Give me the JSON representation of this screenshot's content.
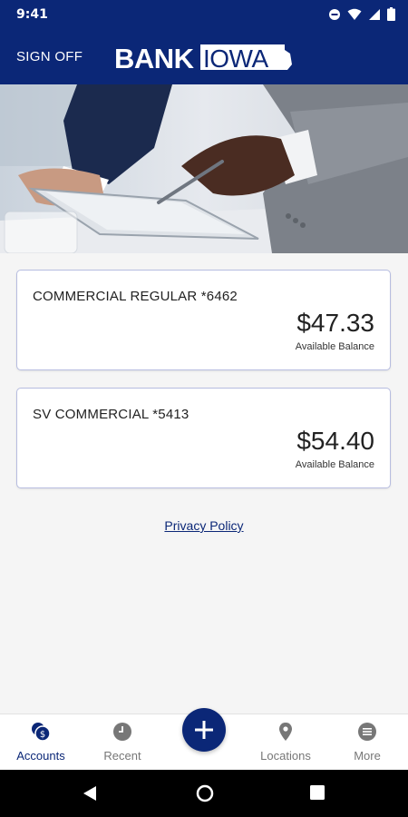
{
  "status_bar": {
    "time": "9:41"
  },
  "header": {
    "sign_off_label": "SIGN OFF",
    "logo_left": "BANK",
    "logo_right": "IOWA"
  },
  "accounts": [
    {
      "name": "COMMERCIAL REGULAR *6462",
      "balance": "$47.33",
      "balance_label": "Available Balance"
    },
    {
      "name": "SV COMMERCIAL *5413",
      "balance": "$54.40",
      "balance_label": "Available Balance"
    }
  ],
  "footer": {
    "privacy_label": "Privacy Policy"
  },
  "bottom_nav": {
    "items": [
      {
        "label": "Accounts",
        "icon": "accounts-icon",
        "active": true
      },
      {
        "label": "Recent",
        "icon": "clock-icon"
      },
      {
        "label": "Locations",
        "icon": "location-pin-icon"
      },
      {
        "label": "More",
        "icon": "menu-icon"
      }
    ],
    "fab_icon": "plus-icon"
  },
  "colors": {
    "brand": "#0b2777",
    "inactive": "#777777",
    "card_border": "#b7bde0"
  }
}
